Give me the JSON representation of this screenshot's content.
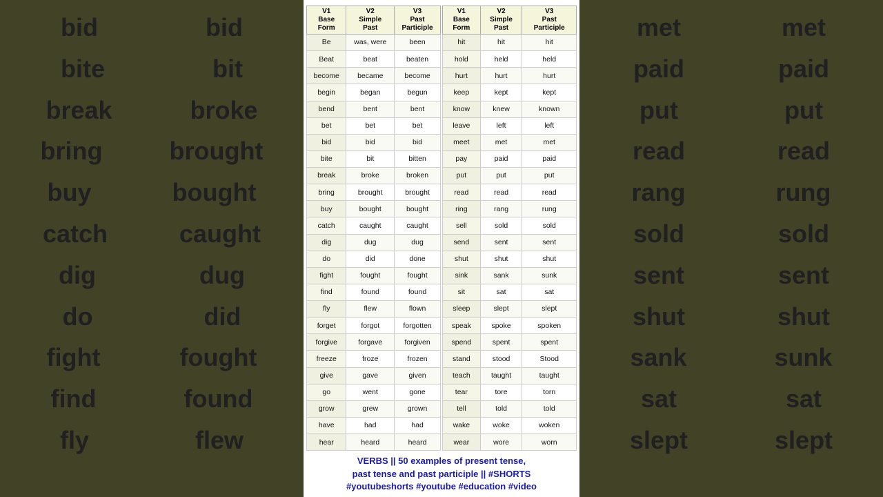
{
  "left_panel": {
    "col1": [
      "bid",
      "bite",
      "break",
      "bring",
      "buy",
      "catch",
      "dig",
      "do",
      "fight",
      "find",
      "fly"
    ],
    "col2": [
      "bid",
      "bit",
      "broke",
      "brought",
      "bought",
      "caught",
      "dug",
      "did",
      "fought",
      "found",
      "flew"
    ]
  },
  "right_panel": {
    "col1": [
      "met",
      "paid",
      "put",
      "read",
      "rang",
      "sold",
      "sent",
      "shut",
      "sank",
      "sat",
      "slept"
    ],
    "col2": [
      "met",
      "paid",
      "put",
      "read",
      "rung",
      "sold",
      "sent",
      "shut",
      "sunk",
      "sat",
      "slept"
    ]
  },
  "table1": {
    "headers": [
      "V1\nBase\nForm",
      "V2\nSimple\nPast",
      "V3\nPast\nParticiple"
    ],
    "rows": [
      [
        "Be",
        "was, were",
        "been"
      ],
      [
        "Beat",
        "beat",
        "beaten"
      ],
      [
        "become",
        "became",
        "become"
      ],
      [
        "begin",
        "began",
        "begun"
      ],
      [
        "bend",
        "bent",
        "bent"
      ],
      [
        "bet",
        "bet",
        "bet"
      ],
      [
        "bid",
        "bid",
        "bid"
      ],
      [
        "bite",
        "bit",
        "bitten"
      ],
      [
        "break",
        "broke",
        "broken"
      ],
      [
        "bring",
        "brought",
        "brought"
      ],
      [
        "buy",
        "bought",
        "bought"
      ],
      [
        "catch",
        "caught",
        "caught"
      ],
      [
        "dig",
        "dug",
        "dug"
      ],
      [
        "do",
        "did",
        "done"
      ],
      [
        "fight",
        "fought",
        "fought"
      ],
      [
        "find",
        "found",
        "found"
      ],
      [
        "fly",
        "flew",
        "flown"
      ],
      [
        "forget",
        "forgot",
        "forgotten"
      ],
      [
        "forgive",
        "forgave",
        "forgiven"
      ],
      [
        "freeze",
        "froze",
        "frozen"
      ],
      [
        "give",
        "gave",
        "given"
      ],
      [
        "go",
        "went",
        "gone"
      ],
      [
        "grow",
        "grew",
        "grown"
      ],
      [
        "have",
        "had",
        "had"
      ],
      [
        "hear",
        "heard",
        "heard"
      ]
    ]
  },
  "table2": {
    "headers": [
      "V1\nBase\nForm",
      "V2\nSimple\nPast",
      "V3\nPast\nParticiple"
    ],
    "rows": [
      [
        "hit",
        "hit",
        "hit"
      ],
      [
        "hold",
        "held",
        "held"
      ],
      [
        "hurt",
        "hurt",
        "hurt"
      ],
      [
        "keep",
        "kept",
        "kept"
      ],
      [
        "know",
        "knew",
        "known"
      ],
      [
        "leave",
        "left",
        "left"
      ],
      [
        "meet",
        "met",
        "met"
      ],
      [
        "pay",
        "paid",
        "paid"
      ],
      [
        "put",
        "put",
        "put"
      ],
      [
        "read",
        "read",
        "read"
      ],
      [
        "ring",
        "rang",
        "rung"
      ],
      [
        "sell",
        "sold",
        "sold"
      ],
      [
        "send",
        "sent",
        "sent"
      ],
      [
        "shut",
        "shut",
        "shut"
      ],
      [
        "sink",
        "sank",
        "sunk"
      ],
      [
        "sit",
        "sat",
        "sat"
      ],
      [
        "sleep",
        "slept",
        "slept"
      ],
      [
        "speak",
        "spoke",
        "spoken"
      ],
      [
        "spend",
        "spent",
        "spent"
      ],
      [
        "stand",
        "stood",
        "Stood"
      ],
      [
        "teach",
        "taught",
        "taught"
      ],
      [
        "tear",
        "tore",
        "torn"
      ],
      [
        "tell",
        "told",
        "told"
      ],
      [
        "wake",
        "woke",
        "woken"
      ],
      [
        "wear",
        "wore",
        "worn"
      ]
    ]
  },
  "caption": "VERBS || 50 examples of present tense,\npast tense and past participle || #SHORTS\n#youtubeshorts #youtube #education #video"
}
